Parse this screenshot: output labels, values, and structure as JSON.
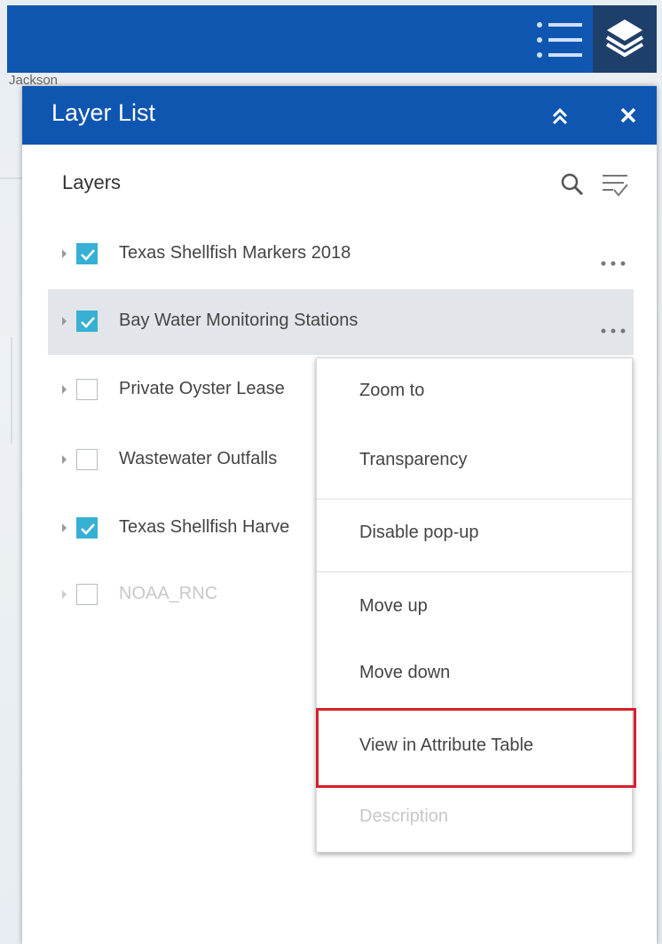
{
  "map": {
    "place_label": "Jackson"
  },
  "topbar": {
    "list_icon": "layer-list-icon",
    "layers_icon": "layers-stack-icon"
  },
  "panel": {
    "title": "Layer List",
    "section_title": "Layers",
    "layers": [
      {
        "label": "Texas Shellfish Markers 2018",
        "checked": true,
        "selected": false,
        "disabled": false
      },
      {
        "label": "Bay Water Monitoring Stations",
        "checked": true,
        "selected": true,
        "disabled": false
      },
      {
        "label": "Private Oyster Lease",
        "checked": false,
        "selected": false,
        "disabled": false
      },
      {
        "label": "Wastewater Outfalls",
        "checked": false,
        "selected": false,
        "disabled": false
      },
      {
        "label": "Texas Shellfish Harve",
        "checked": true,
        "selected": false,
        "disabled": false
      },
      {
        "label": "NOAA_RNC",
        "checked": false,
        "selected": false,
        "disabled": true
      }
    ]
  },
  "menu": {
    "items": [
      {
        "label": "Zoom to",
        "disabled": false
      },
      {
        "label": "Transparency",
        "disabled": false
      },
      {
        "label": "Disable pop-up",
        "disabled": false
      },
      {
        "label": "Move up",
        "disabled": false
      },
      {
        "label": "Move down",
        "disabled": false
      },
      {
        "label": "View in Attribute Table",
        "disabled": false
      },
      {
        "label": "Description",
        "disabled": true
      }
    ]
  },
  "colors": {
    "header_blue": "#0f56b1",
    "checkbox_blue": "#38b0d4",
    "highlight_red": "#d6202a",
    "selected_row": "#e2e5e9"
  }
}
